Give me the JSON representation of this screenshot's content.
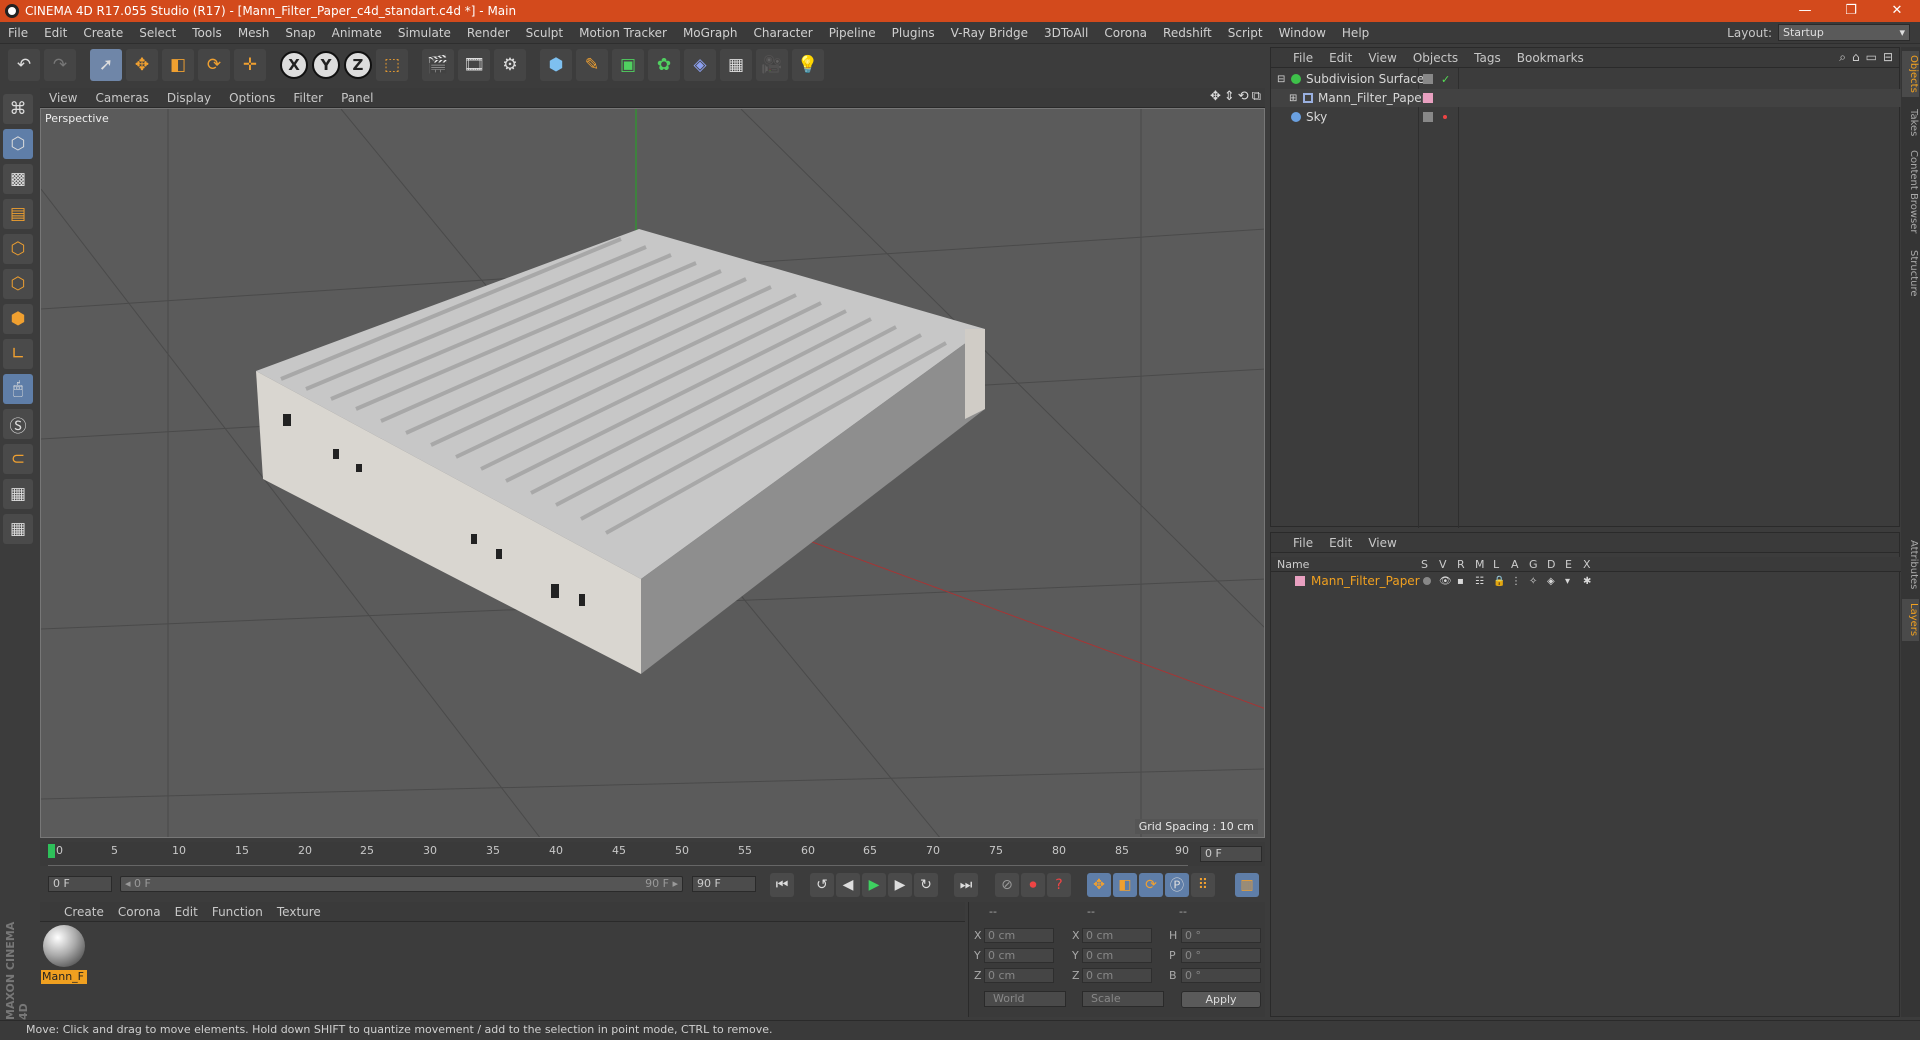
{
  "title": "CINEMA 4D R17.055 Studio (R17) - [Mann_Filter_Paper_c4d_standart.c4d *] - Main",
  "window_buttons": [
    "—",
    "❐",
    "✕"
  ],
  "menu": [
    "File",
    "Edit",
    "Create",
    "Select",
    "Tools",
    "Mesh",
    "Snap",
    "Animate",
    "Simulate",
    "Render",
    "Sculpt",
    "Motion Tracker",
    "MoGraph",
    "Character",
    "Pipeline",
    "Plugins",
    "V-Ray Bridge",
    "3DToAll",
    "Corona",
    "Redshift",
    "Script",
    "Window",
    "Help"
  ],
  "layout": {
    "label": "Layout:",
    "value": "Startup"
  },
  "viewport": {
    "menu": [
      "View",
      "Cameras",
      "Display",
      "Options",
      "Filter",
      "Panel"
    ],
    "label": "Perspective",
    "grid_spacing": "Grid Spacing : 10 cm"
  },
  "timeline": {
    "ticks": [
      "0",
      "5",
      "10",
      "15",
      "20",
      "25",
      "30",
      "35",
      "40",
      "45",
      "50",
      "55",
      "60",
      "65",
      "70",
      "75",
      "80",
      "85",
      "90"
    ],
    "current_frame": "0 F",
    "start_field": "0 F",
    "range_start": "◂ 0 F",
    "range_end": "90 F ▸",
    "end_field": "90 F"
  },
  "material": {
    "menu": [
      "Create",
      "Corona",
      "Edit",
      "Function",
      "Texture"
    ],
    "name": "Mann_F"
  },
  "coords": {
    "headers": [
      "--",
      "--",
      "--"
    ],
    "rows": [
      {
        "a": "X",
        "av": "0 cm",
        "b": "X",
        "bv": "0 cm",
        "c": "H",
        "cv": "0 °"
      },
      {
        "a": "Y",
        "av": "0 cm",
        "b": "Y",
        "bv": "0 cm",
        "c": "P",
        "cv": "0 °"
      },
      {
        "a": "Z",
        "av": "0 cm",
        "b": "Z",
        "bv": "0 cm",
        "c": "B",
        "cv": "0 °"
      }
    ],
    "mode1": "World",
    "mode2": "Scale",
    "apply": "Apply"
  },
  "objects": {
    "menu": [
      "File",
      "Edit",
      "View",
      "Objects",
      "Tags",
      "Bookmarks"
    ],
    "items": [
      {
        "name": "Subdivision Surface",
        "color": "#3ec24a"
      },
      {
        "name": "Mann_Filter_Paper",
        "color": "#9ab0e0"
      },
      {
        "name": "Sky",
        "color": "#6aa0e0"
      }
    ]
  },
  "layers": {
    "menu": [
      "File",
      "Edit",
      "View"
    ],
    "header_name": "Name",
    "header_flags": [
      "S",
      "V",
      "R",
      "M",
      "L",
      "A",
      "G",
      "D",
      "E",
      "X"
    ],
    "items": [
      {
        "name": "Mann_Filter_Paper",
        "color": "#e8a0c0"
      }
    ]
  },
  "side_tabs": [
    "Objects",
    "Takes",
    "Content Browser",
    "Structure",
    "Attributes",
    "Layers"
  ],
  "status": "Move: Click and drag to move elements. Hold down SHIFT to quantize movement / add to the selection in point mode, CTRL to remove.",
  "brand": "MAXON CINEMA 4D",
  "accent_color": "#f0a020",
  "title_color": "#d34a1c"
}
